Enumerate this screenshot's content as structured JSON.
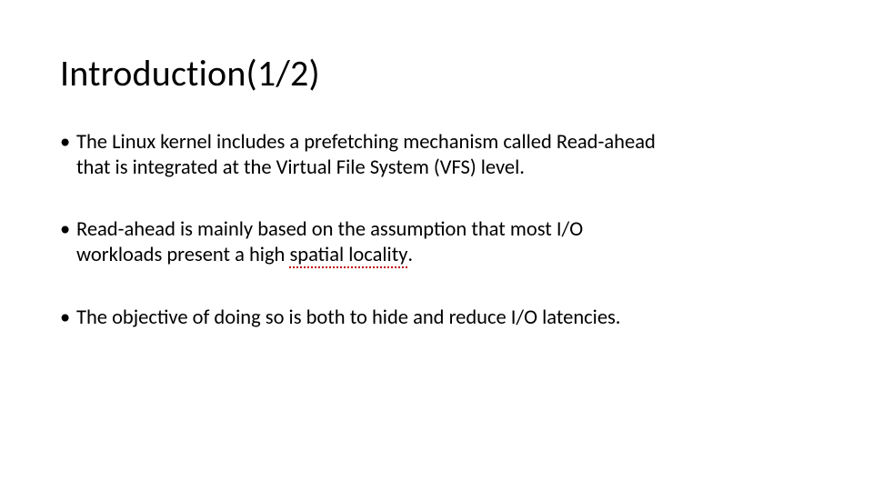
{
  "title": "Introduction(1/2)",
  "bullets": [
    {
      "line1": "The Linux kernel includes a prefetching mechanism called Read-ahead",
      "line2": "that is integrated at the Virtual File System (VFS) level."
    },
    {
      "line1": "Read-ahead is mainly based on the assumption that most I/O",
      "line2a": "workloads present a high ",
      "err": "spatial locality",
      "line2b": "."
    },
    {
      "line1": "The objective of doing so is both to hide and reduce I/O latencies."
    }
  ]
}
